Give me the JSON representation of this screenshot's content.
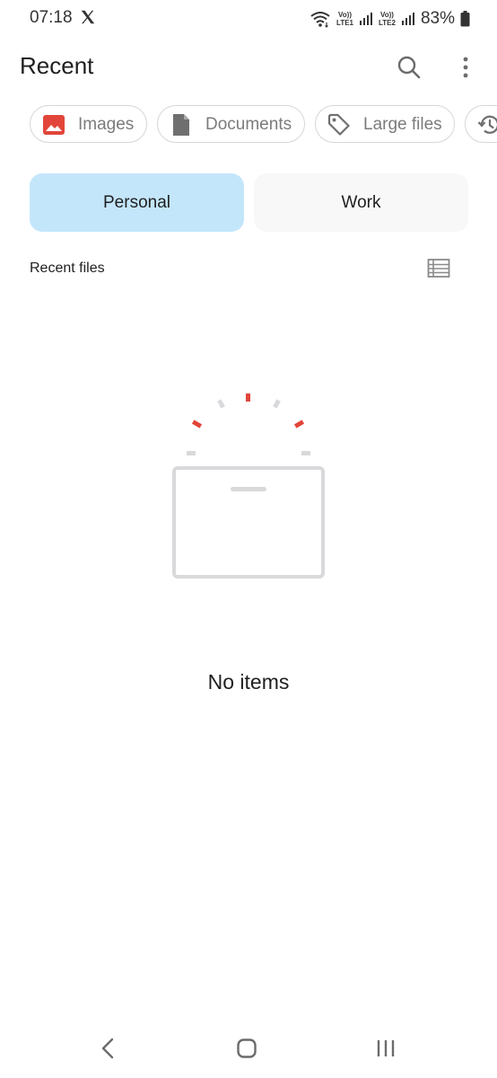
{
  "status_bar": {
    "time": "07:18",
    "battery": "83%",
    "lte1": [
      "Vo))",
      "LTE1"
    ],
    "lte2": [
      "Vo))",
      "LTE2"
    ]
  },
  "header": {
    "title": "Recent"
  },
  "chips": [
    {
      "label": "Images",
      "icon": "image-icon",
      "color": "#e2463a"
    },
    {
      "label": "Documents",
      "icon": "document-icon",
      "color": "#6f6f6f"
    },
    {
      "label": "Large files",
      "icon": "tag-icon",
      "color": "#6f6f6f"
    },
    {
      "label": "",
      "icon": "history-icon",
      "color": "#6f6f6f"
    }
  ],
  "tabs": {
    "personal": "Personal",
    "work": "Work",
    "active_color": "#c4e6fb"
  },
  "section": {
    "label": "Recent files"
  },
  "empty_state": {
    "message": "No items"
  },
  "colors": {
    "accent_red": "#e2463a",
    "illustration_gray": "#d9d9dc"
  }
}
